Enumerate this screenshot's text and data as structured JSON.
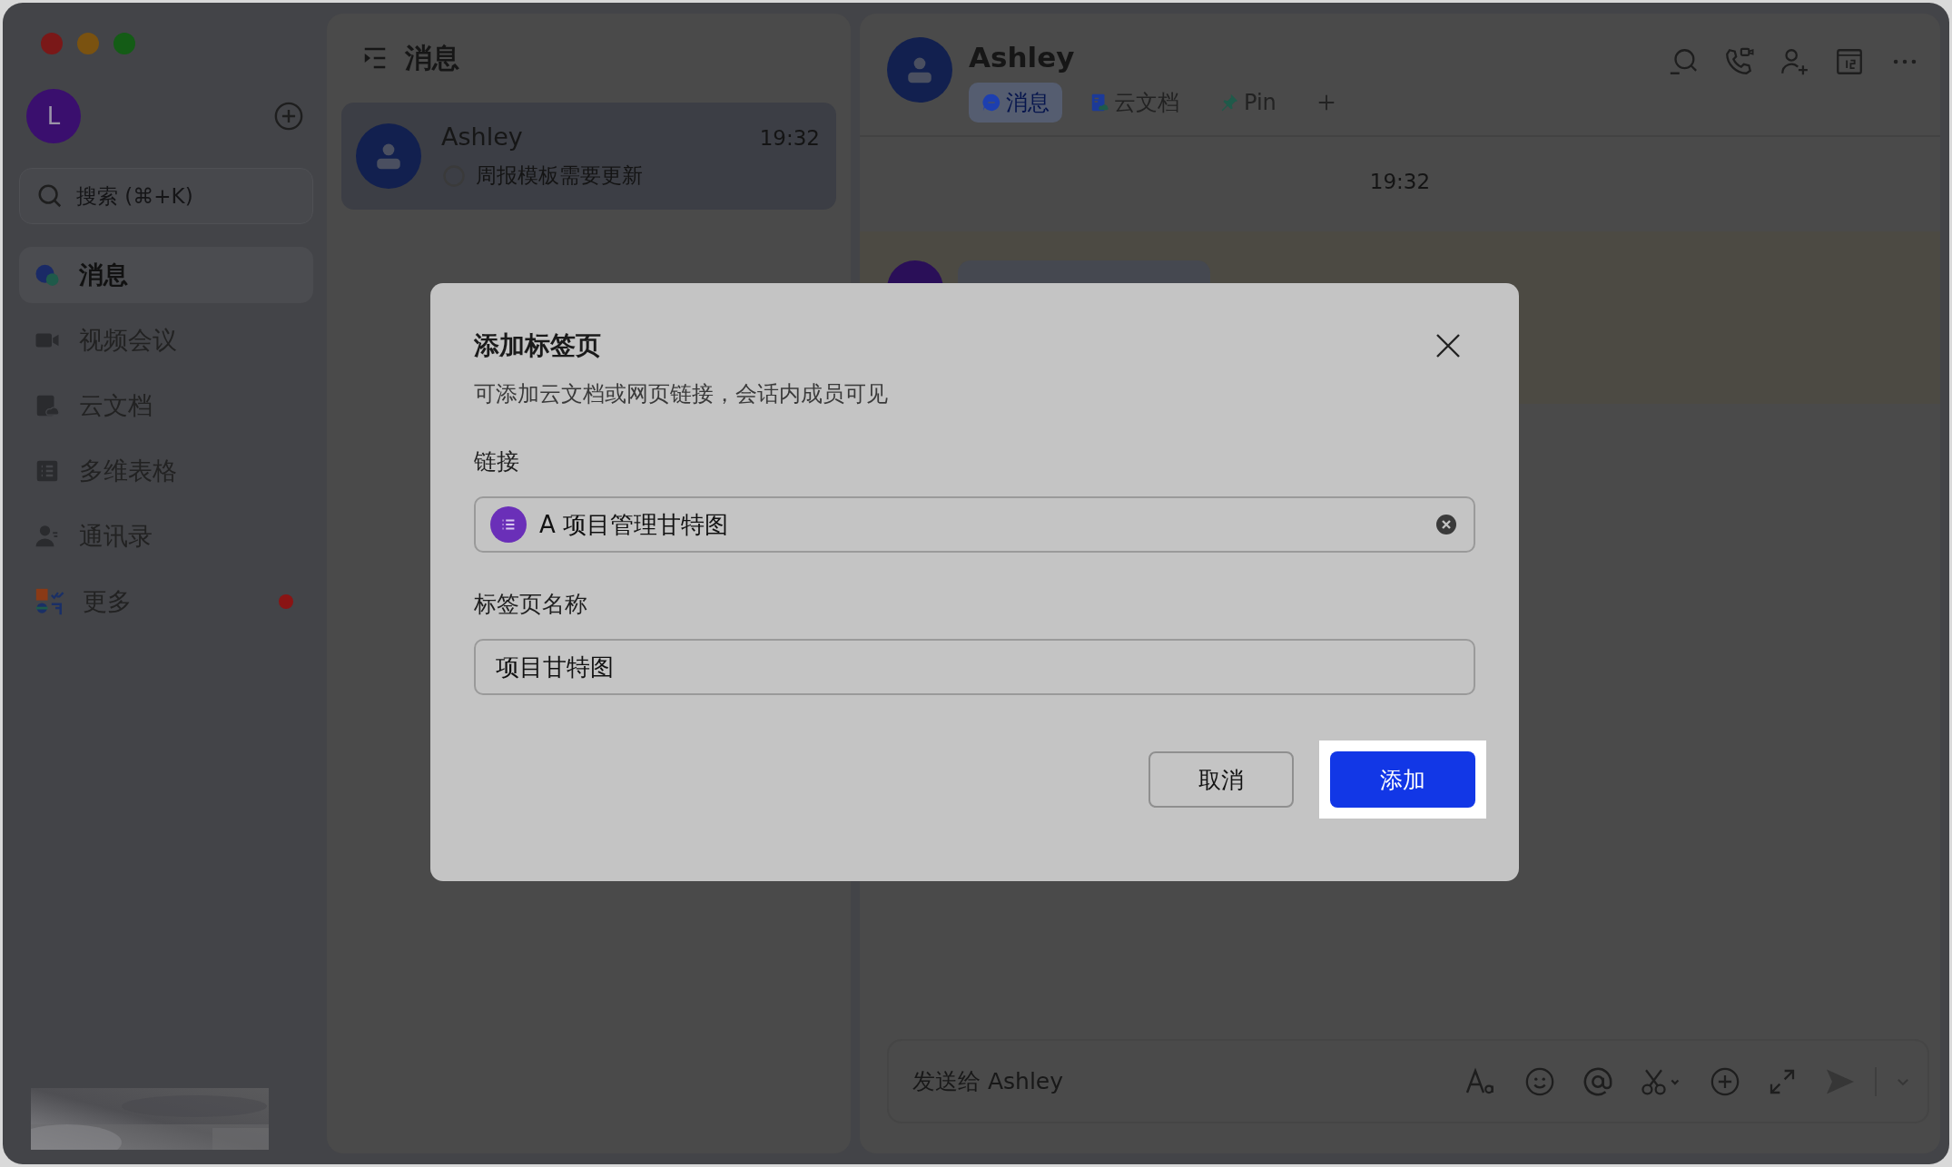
{
  "sidebar": {
    "avatar_letter": "L",
    "search": {
      "placeholder": "搜索 (⌘+K)"
    },
    "items": [
      {
        "label": "消息",
        "kind": "chat",
        "selected": true,
        "badge": false
      },
      {
        "label": "视频会议",
        "kind": "video",
        "selected": false,
        "badge": false
      },
      {
        "label": "云文档",
        "kind": "doc",
        "selected": false,
        "badge": false
      },
      {
        "label": "多维表格",
        "kind": "table",
        "selected": false,
        "badge": false
      },
      {
        "label": "通讯录",
        "kind": "contacts",
        "selected": false,
        "badge": false
      },
      {
        "label": "更多",
        "kind": "apps",
        "selected": false,
        "badge": true
      }
    ]
  },
  "chat_list": {
    "title": "消息",
    "conversations": [
      {
        "name": "Ashley",
        "time": "19:32",
        "preview": "周报模板需要更新",
        "selected": true
      }
    ]
  },
  "chat": {
    "name": "Ashley",
    "tabs": [
      {
        "label": "消息",
        "kind": "chat",
        "selected": true
      },
      {
        "label": "云文档",
        "kind": "doc",
        "selected": false
      },
      {
        "label": "Pin",
        "kind": "pin",
        "selected": false
      }
    ],
    "timestamp": "19:32",
    "composer": {
      "placeholder": "发送给 Ashley"
    }
  },
  "dialog": {
    "title": "添加标签页",
    "subtitle": "可添加云文档或网页链接，会话内成员可见",
    "fields": [
      {
        "label": "链接",
        "kind": "link",
        "value": "A 项目管理甘特图"
      },
      {
        "label": "标签页名称",
        "kind": "text",
        "value": "项目甘特图"
      }
    ],
    "buttons": [
      {
        "label": "取消",
        "kind": "secondary",
        "highlighted": false
      },
      {
        "label": "添加",
        "kind": "primary",
        "highlighted": true
      }
    ]
  }
}
